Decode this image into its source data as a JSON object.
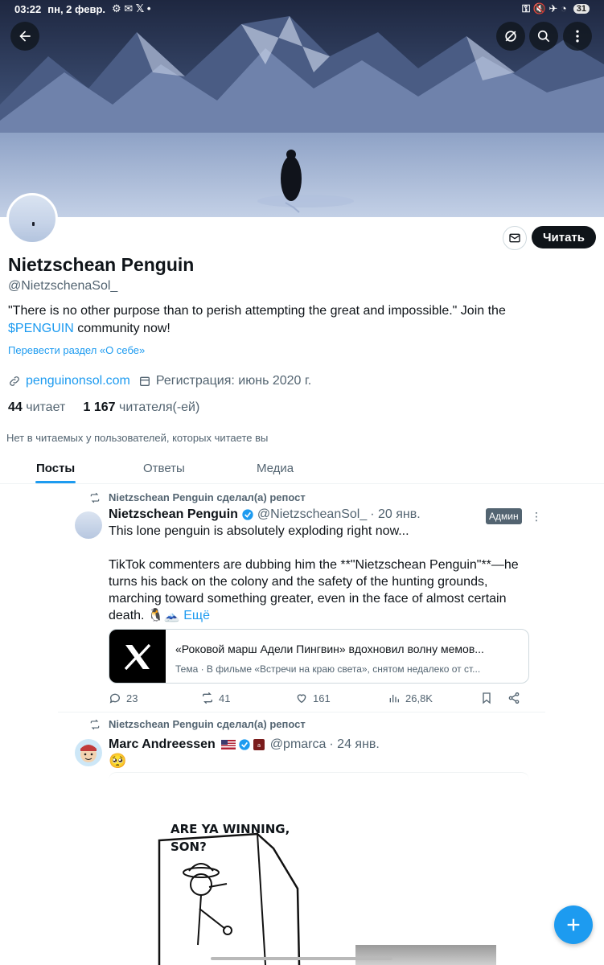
{
  "status_bar": {
    "time": "03:22",
    "date": "пн, 2 февр.",
    "battery": "31"
  },
  "profile": {
    "name": "Nietzschean Penguin",
    "handle": "@NietzschenaSol_",
    "bio_part1": "\"There is no other purpose than to perish attempting the great and impossible.\"  Join the ",
    "bio_link": "$PENGUIN",
    "bio_part2": " community now!",
    "translate": "Перевести раздел «О себе»",
    "website": "penguinonsol.com",
    "joined": "Регистрация: июнь 2020 г.",
    "following_count": "44",
    "following_label": "читает",
    "followers_count": "1 167",
    "followers_label": "читателя(-ей)",
    "no_common": "Нет в читаемых у пользователей, которых читаете вы",
    "follow_button": "Читать"
  },
  "tabs": [
    {
      "label": "Посты",
      "active": true
    },
    {
      "label": "Ответы",
      "active": false
    },
    {
      "label": "Медиа",
      "active": false
    }
  ],
  "tweets": [
    {
      "repost_by": "Nietzschean Penguin сделал(а) репост",
      "author": "Nietzschean Penguin",
      "handle": "@NietzscheanSol_",
      "time": "· 20 янв.",
      "badge": "Админ",
      "line1": "This lone penguin is absolutely exploding right now...",
      "para2": "TikTok commenters are dubbing him the **\"Nietzschean Penguin\"**—he turns his back on the colony and the safety of the hunting grounds, marching toward something greater, even in the face of almost certain death. 🐧🗻",
      "more": "Ещё",
      "card_title": "«Роковой марш Адели Пингвин» вдохновил волну мемов...",
      "card_sub": "Тема · В фильме «Встречи на краю света», снятом недалеко от ст...",
      "replies": "23",
      "reposts": "41",
      "likes": "161",
      "views": "26,8K"
    },
    {
      "repost_by": "Nietzschean Penguin сделал(а) репост",
      "author": "Marc Andreessen",
      "handle": "@pmarca",
      "time": "· 24 янв.",
      "text": "🥺",
      "meme_line1": "ARE YA WINNING,",
      "meme_line2": "SON?"
    }
  ],
  "icons": [
    "back-arrow-icon",
    "no-data-icon",
    "search-icon",
    "more-vert-icon",
    "mail-icon",
    "link-icon",
    "calendar-icon",
    "repost-icon",
    "verified-icon",
    "reply-icon",
    "like-icon",
    "views-icon",
    "bookmark-icon",
    "share-icon",
    "plus-icon"
  ],
  "colors": {
    "accent": "#1d9bf0",
    "text": "#0f1419",
    "secondary": "#536471"
  }
}
